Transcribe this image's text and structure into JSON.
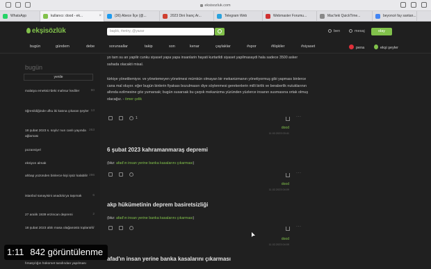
{
  "browser": {
    "url": "eksisozluk.com",
    "tabs": [
      {
        "label": "WhatsApp",
        "color": "#25d366",
        "active": false,
        "width": 58
      },
      {
        "label": "kullanıcı: dood - ek...",
        "color": "#81c14b",
        "active": true,
        "width": 92
      },
      {
        "label": "(36) Abece İlçe (@...",
        "color": "#1d9bf0",
        "active": false,
        "width": 80
      },
      {
        "label": "2023 Dini İnanç Ar...",
        "color": "#d04030",
        "active": false,
        "width": 78
      },
      {
        "label": "Telegram Web",
        "color": "#2aa3de",
        "active": false,
        "width": 70
      },
      {
        "label": "Webmaster Forumu...",
        "color": "#d03030",
        "active": false,
        "width": 78
      },
      {
        "label": "Mac'teki QuickTime...",
        "color": "#888888",
        "active": false,
        "width": 80
      },
      {
        "label": "beyoncé fay santan...",
        "color": "#4285f4",
        "active": false,
        "width": 64
      }
    ]
  },
  "header": {
    "logo": "ekşisözlük",
    "search_placeholder": "başlık, #entry, @yazar",
    "user_label": "ben",
    "messages_label": "mesaj",
    "olay_label": "olay"
  },
  "nav": {
    "items": [
      "bugün",
      "gündem",
      "debe",
      "sorunsallar",
      "takip",
      "son",
      "kenar",
      "çaylaklar",
      "#spor",
      "#ilişkiler",
      "#siyaset"
    ],
    "pena": "pena",
    "eksi_seyler": "ekşi şeyler"
  },
  "sidebar": {
    "title": "bugün",
    "refresh": "yenile",
    "items": [
      {
        "text": "malatya emeksiz'deki mahsur kediler",
        "count": "90"
      },
      {
        "text": "öğrenildiğinde ufku iki katına çıkaran şeyler",
        "count": "13"
      },
      {
        "text": "18 şubat 2023 s. soylu' nun canlı yayında ağlaması",
        "count": "263"
      },
      {
        "text": "pozansiyel",
        "count": ""
      },
      {
        "text": "eksiyon almak",
        "count": ""
      },
      {
        "text": "ahbap yüzünden binlerce kişi işsiz kalabilir",
        "count": "286"
      },
      {
        "text": "istanbul sanayisini anadolu'ya taşımak",
        "count": "6"
      },
      {
        "text": "27 aralık 1939 erzincan depremi",
        "count": "2"
      },
      {
        "text": "18 şubat 2023 altılı masa olağanüstü toplantısı",
        "count": "32"
      }
    ],
    "bottom_partial": "fırsatçılığın hükümet tarafından yapılması"
  },
  "content": {
    "para1": "yo tam su an yapilir cunku siyaset yapa yapa insanlarin hayati kurtarildi siyaset yapilmasaydi hala sadece 3500 asker sahada olacakti misal.",
    "para2": "türkiye yönetilemiyor. ve yönetemeyen yönetmesi mümkün olmayan bir mekanizmanın yönetiyormuş gibi yapması binlerce cana mal oluyor. eğer bugün binlerin fiyakası bozulmasın diye söylenmesi gerekenlerin milli birlik ve beraberlik nutuklarının altında ezilmesine göz yumarsak; bugün susarsak bu çarpık mekanizma yüzünden yüzlerce insanın susmasına ortak olmuş olacağız.",
    "para2_link": "ömer çelik",
    "entry1": {
      "fav_count": "1",
      "author": "dood",
      "date": "11.02.2023 03:41"
    },
    "heading2": "6 şubat 2023 kahramanmaraş depremi",
    "bkz2_prefix": "(bkz:",
    "bkz2_link": "afad'ın insan yerine banka kasalarını çıkarması",
    "bkz2_suffix": ")",
    "entry2": {
      "author": "dood",
      "date": "11.02.2023 04:09"
    },
    "heading3": "akp hükümetinin deprem basiretsizliği",
    "bkz3_prefix": "(bkz:",
    "bkz3_link": "afad'ın insan yerine banka kasalarını çıkarması",
    "bkz3_suffix": ")",
    "entry3": {
      "author": "dood",
      "date": "11.02.2023 04:09"
    },
    "heading4": "afad'ın insan yerine banka kasalarını çıkarması"
  },
  "video": {
    "time": "1:11",
    "views": "842 görüntülenme"
  }
}
